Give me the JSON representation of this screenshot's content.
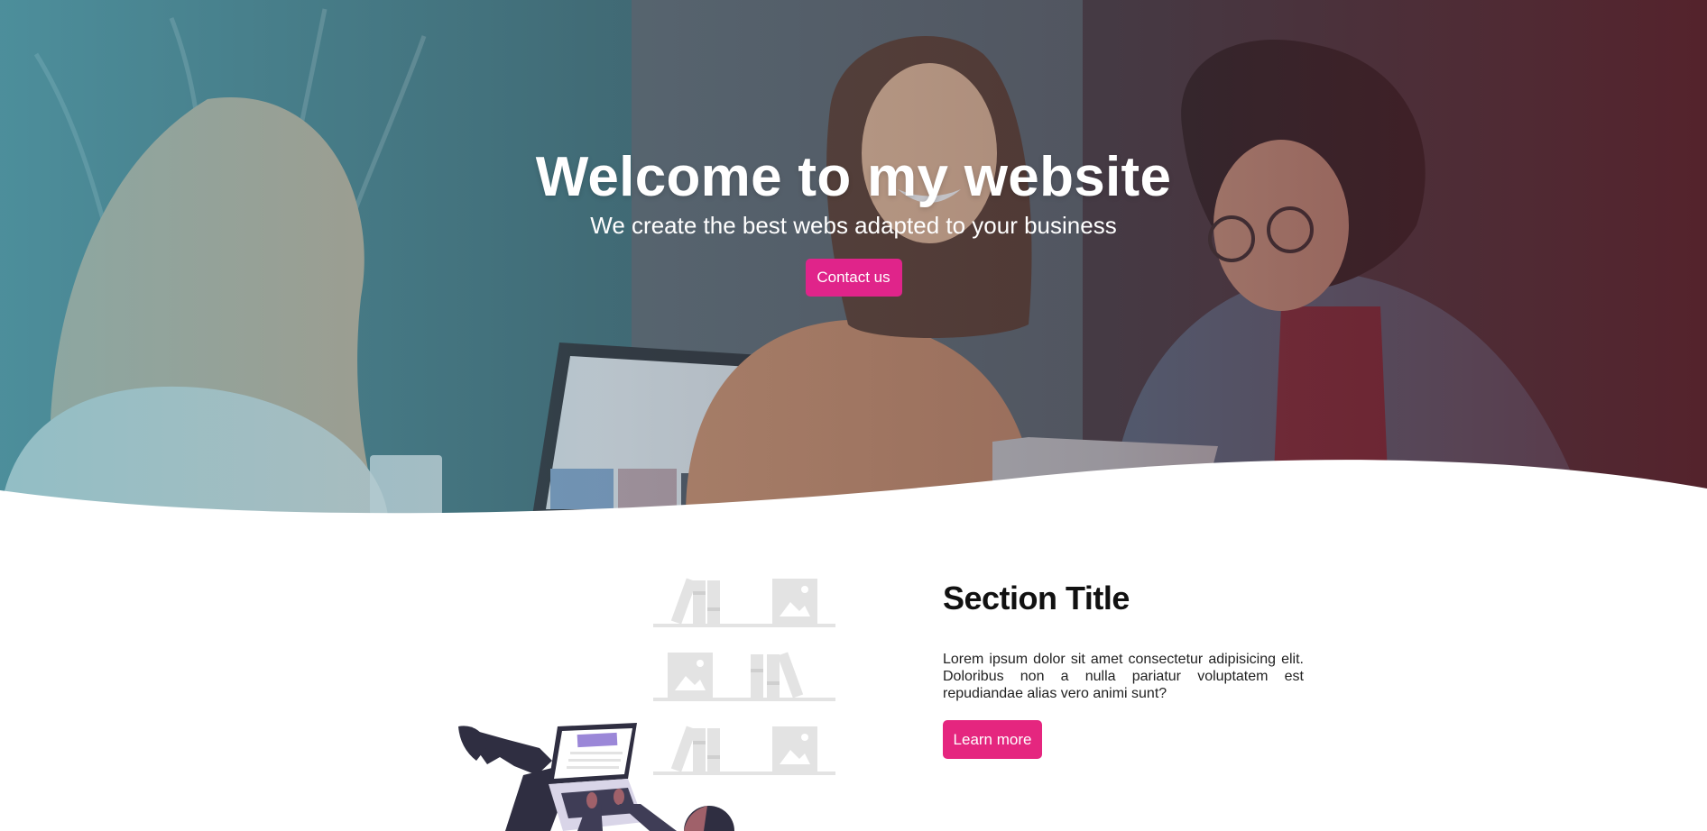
{
  "hero": {
    "title": "Welcome to my website",
    "subtitle": "We create the best webs adapted to your business",
    "cta_label": "Contact us"
  },
  "section": {
    "title": "Section Title",
    "body": "Lorem ipsum dolor sit amet consectetur adipisicing elit. Doloribus non a nulla pariatur voluptatem est repudiandae alias vero animi sunt?",
    "cta_label": "Learn more"
  },
  "colors": {
    "accent": "#e5267f",
    "heading": "#111111",
    "background": "#ffffff"
  }
}
